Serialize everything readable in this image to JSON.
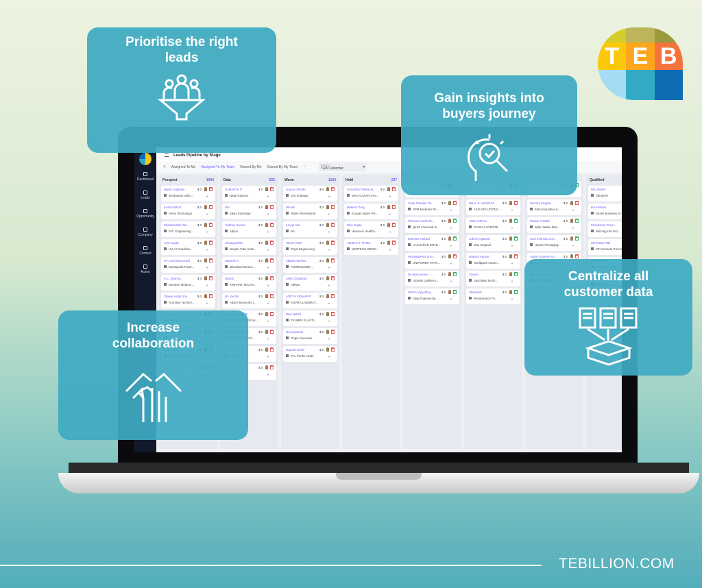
{
  "brand": {
    "logo_letters": [
      "T",
      "E",
      "B"
    ],
    "logo_colors": [
      "#d4cb2c",
      "#bdb55c",
      "#989a3c",
      "#fcc80c",
      "#fca61c",
      "#f4743c",
      "#a4dcf4",
      "#33aac4",
      "#0c6cb4"
    ],
    "website": "TEBILLION.COM",
    "accent": "#3eaac2"
  },
  "callouts": {
    "prioritise": "Prioritise the right leads",
    "insights": "Gain insights into buyers journey",
    "centralize": "Centralize all customer data",
    "collaboration": "Increase collaboration"
  },
  "app": {
    "title": "Leads Pipeline by Stage",
    "sidebar": [
      {
        "label": "Dashboard",
        "icon": "dashboard-icon"
      },
      {
        "label": "Leads",
        "icon": "leads-icon"
      },
      {
        "label": "Opportunity",
        "icon": "opportunity-icon"
      },
      {
        "label": "Company",
        "icon": "company-icon"
      },
      {
        "label": "Contact",
        "icon": "contact-icon"
      },
      {
        "label": "Action",
        "icon": "action-icon"
      }
    ],
    "filters": [
      "Assigned To Me",
      "Assigned To My Team",
      "Owned By Me",
      "Owned By My Team"
    ],
    "active_filter": 1,
    "workflow": {
      "label": "Workflow *",
      "value": "TEB Customer"
    },
    "columns": [
      {
        "name": "Prospect",
        "count": "1094",
        "cards": [
          [
            "Nilesh Gadhave",
            "Jendamark India ..."
          ],
          [
            "Kiran Rathod",
            "Aetos Technology"
          ],
          [
            "Shambhubhai Tal...",
            "S.R. Engineering ..."
          ],
          [
            "Amit Gupta",
            "HV Air Condition..."
          ],
          [
            "R K Iyer(Staucorod)",
            "Dynaspede Powe..."
          ],
          [
            "K.C. Sharma",
            "Newtech Medical ..."
          ],
          [
            "Tajveer singh Sho...",
            "Accretive Technol..."
          ],
          [
            "Shikha Dua",
            "Signity Software ..."
          ],
          [
            "Saikumar Thevar",
            "Lauren Informatio..."
          ],
          [
            "Niraj Shah",
            "Network Techlab ..."
          ],
          [
            "Soumitra Saha",
            ""
          ]
        ]
      },
      {
        "name": "Data",
        "count": "922",
        "cards": [
          [
            "SAMANTH P",
            "Nata Robotics"
          ],
          [
            "Ilan",
            "Ideas Exchange"
          ],
          [
            "Vaibhav Shinde",
            "Adijna"
          ],
          [
            "Chirag Mehta",
            "Gayatri Tube India"
          ],
          [
            "Satwesh A",
            "Bhoruka Fabcons ..."
          ],
          [
            "Bhavin",
            "ARIHANT TECHN..."
          ],
          [
            "Mr. Sachin",
            "A&D Instruments I..."
          ],
          [
            "SUBRATA BANIK",
            "BANIK RUBBER IN..."
          ],
          [
            "Avinash N Kawale",
            "Avcon Controls P..."
          ],
          [
            "K. Raja Sekhar",
            "Fractal"
          ],
          [
            "Ashish Gupta",
            ""
          ]
        ]
      },
      {
        "name": "Warm",
        "count": "1150",
        "cards": [
          [
            "Gaurav Shinde",
            "SGI Kolhapur"
          ],
          [
            "Dinesh",
            "Radin International"
          ],
          [
            "Ameyt Jain",
            "NA"
          ],
          [
            "Hitesh Patel",
            "Payal Engineering"
          ],
          [
            "ABDUL WAHID",
            "POWERCORE ..."
          ],
          [
            "Ankit Chaudhari",
            "Vibhan"
          ],
          [
            "ADITYA SENAPATI",
            "ADVIKA LABORAT..."
          ],
          [
            "Ravi Dabhil",
            "TRUMPF PLASTI..."
          ],
          [
            "Neeraj Desai",
            "Origin Overseas ..."
          ],
          [
            "Rupesh Doshi",
            "Pro. Penfin Healt..."
          ]
        ]
      },
      {
        "name": "Hold",
        "count": "237",
        "cards": [
          [
            "SANJEEV SINGHAL",
            "MAG GASAR SYS..."
          ],
          [
            "Mukesh Garg",
            "Ecogas Impex Pvt..."
          ],
          [
            "Nitin Gupta",
            "Hansonic Healtho..."
          ],
          [
            "AMISHA T. PATEL",
            "NEOTECH MEDIC..."
          ]
        ]
      },
      {
        "name": "",
        "count": "",
        "cards": [
          [
            "",
            ""
          ],
          [
            "Vivek Shankar Pa...",
            "SPM Medicare Pv..."
          ],
          [
            "Shravan Kumar M...",
            "Qirish Chemical In..."
          ],
          [
            "Manohar Paliwal",
            "AACHARAN ENTE..."
          ],
          [
            "PRADEEPAN SIVA...",
            "UNIPOWER TRAN..."
          ],
          [
            "Mr.vikas kumar - ...",
            "Alchelm Unitherm..."
          ],
          [
            "Dhiren Vijay Bhoj...",
            "Vijay Engineering ..."
          ]
        ]
      },
      {
        "name": "",
        "count": "",
        "cards": [
          [
            "",
            ""
          ],
          [
            "BIJAL D. SANGHVI",
            "AXIS SOLUTIONS ..."
          ],
          [
            "ANUJ GOYAL",
            "GAJRAJ AGROTE..."
          ],
          [
            "Lokesh Agarwal",
            "Isha Surgical"
          ],
          [
            "Mukesh Ajmani",
            "Worldpack Autom..."
          ],
          [
            "Chetan",
            "Suschaka Techn..."
          ],
          [
            "Sharwesh",
            "Renaissance Fo..."
          ]
        ]
      },
      {
        "name": "",
        "count": "",
        "cards": [
          [
            "",
            ""
          ],
          [
            "Sumant Singhal...",
            "Ester Industries Li..."
          ],
          [
            "Pranav Tripathi",
            "Biotic Waste Man..."
          ],
          [
            "Ravi Krishnamoch...",
            "Hassle Packaging..."
          ],
          [
            "ANUP KUMAR AG...",
            "SWITCHING AVO..."
          ],
          [
            "Kalpesh Khivasara",
            "Ini Farms Pvt Ltd"
          ]
        ]
      },
      {
        "name": "Qualified",
        "count": "",
        "cards": [
          [
            "Nitu Parikh",
            "ShineLife"
          ],
          [
            "Ravi Bhatia",
            "Dezee Business M..."
          ],
          [
            "Shashikant Khom...",
            "Winning Life Inst..."
          ],
          [
            "Shriniwas Patil",
            "SP Concrete Pvt.Ltd"
          ],
          [
            "Munish Garg",
            "ST KOOL LUBRIC..."
          ],
          [
            "Yogesh Desai",
            "Perennial Technol..."
          ]
        ]
      }
    ],
    "card_amount": "$ 0"
  }
}
